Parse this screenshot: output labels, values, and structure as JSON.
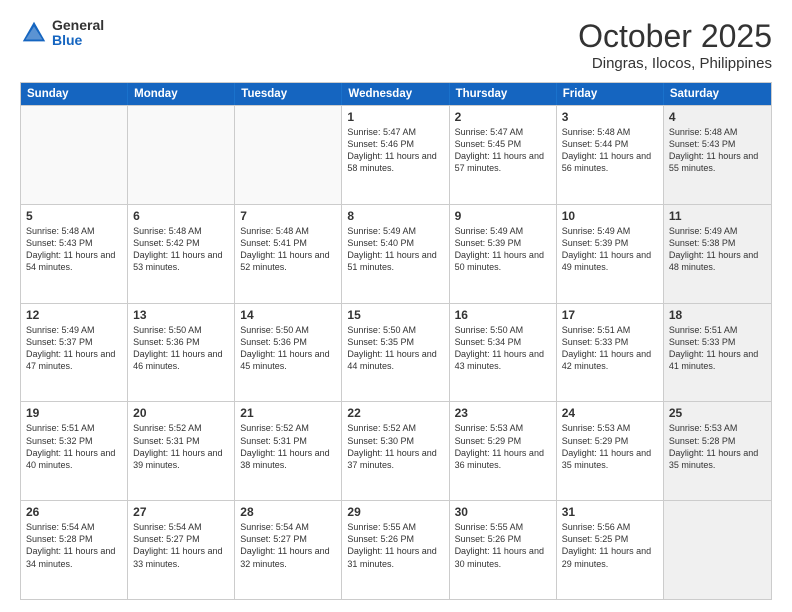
{
  "header": {
    "logo": {
      "general": "General",
      "blue": "Blue"
    },
    "title": "October 2025",
    "subtitle": "Dingras, Ilocos, Philippines"
  },
  "days_of_week": [
    "Sunday",
    "Monday",
    "Tuesday",
    "Wednesday",
    "Thursday",
    "Friday",
    "Saturday"
  ],
  "weeks": [
    [
      {
        "day": "",
        "empty": true
      },
      {
        "day": "",
        "empty": true
      },
      {
        "day": "",
        "empty": true
      },
      {
        "day": "1",
        "sunrise": "Sunrise: 5:47 AM",
        "sunset": "Sunset: 5:46 PM",
        "daylight": "Daylight: 11 hours and 58 minutes."
      },
      {
        "day": "2",
        "sunrise": "Sunrise: 5:47 AM",
        "sunset": "Sunset: 5:45 PM",
        "daylight": "Daylight: 11 hours and 57 minutes."
      },
      {
        "day": "3",
        "sunrise": "Sunrise: 5:48 AM",
        "sunset": "Sunset: 5:44 PM",
        "daylight": "Daylight: 11 hours and 56 minutes."
      },
      {
        "day": "4",
        "sunrise": "Sunrise: 5:48 AM",
        "sunset": "Sunset: 5:43 PM",
        "daylight": "Daylight: 11 hours and 55 minutes.",
        "shaded": true
      }
    ],
    [
      {
        "day": "5",
        "sunrise": "Sunrise: 5:48 AM",
        "sunset": "Sunset: 5:43 PM",
        "daylight": "Daylight: 11 hours and 54 minutes."
      },
      {
        "day": "6",
        "sunrise": "Sunrise: 5:48 AM",
        "sunset": "Sunset: 5:42 PM",
        "daylight": "Daylight: 11 hours and 53 minutes."
      },
      {
        "day": "7",
        "sunrise": "Sunrise: 5:48 AM",
        "sunset": "Sunset: 5:41 PM",
        "daylight": "Daylight: 11 hours and 52 minutes."
      },
      {
        "day": "8",
        "sunrise": "Sunrise: 5:49 AM",
        "sunset": "Sunset: 5:40 PM",
        "daylight": "Daylight: 11 hours and 51 minutes."
      },
      {
        "day": "9",
        "sunrise": "Sunrise: 5:49 AM",
        "sunset": "Sunset: 5:39 PM",
        "daylight": "Daylight: 11 hours and 50 minutes."
      },
      {
        "day": "10",
        "sunrise": "Sunrise: 5:49 AM",
        "sunset": "Sunset: 5:39 PM",
        "daylight": "Daylight: 11 hours and 49 minutes."
      },
      {
        "day": "11",
        "sunrise": "Sunrise: 5:49 AM",
        "sunset": "Sunset: 5:38 PM",
        "daylight": "Daylight: 11 hours and 48 minutes.",
        "shaded": true
      }
    ],
    [
      {
        "day": "12",
        "sunrise": "Sunrise: 5:49 AM",
        "sunset": "Sunset: 5:37 PM",
        "daylight": "Daylight: 11 hours and 47 minutes."
      },
      {
        "day": "13",
        "sunrise": "Sunrise: 5:50 AM",
        "sunset": "Sunset: 5:36 PM",
        "daylight": "Daylight: 11 hours and 46 minutes."
      },
      {
        "day": "14",
        "sunrise": "Sunrise: 5:50 AM",
        "sunset": "Sunset: 5:36 PM",
        "daylight": "Daylight: 11 hours and 45 minutes."
      },
      {
        "day": "15",
        "sunrise": "Sunrise: 5:50 AM",
        "sunset": "Sunset: 5:35 PM",
        "daylight": "Daylight: 11 hours and 44 minutes."
      },
      {
        "day": "16",
        "sunrise": "Sunrise: 5:50 AM",
        "sunset": "Sunset: 5:34 PM",
        "daylight": "Daylight: 11 hours and 43 minutes."
      },
      {
        "day": "17",
        "sunrise": "Sunrise: 5:51 AM",
        "sunset": "Sunset: 5:33 PM",
        "daylight": "Daylight: 11 hours and 42 minutes."
      },
      {
        "day": "18",
        "sunrise": "Sunrise: 5:51 AM",
        "sunset": "Sunset: 5:33 PM",
        "daylight": "Daylight: 11 hours and 41 minutes.",
        "shaded": true
      }
    ],
    [
      {
        "day": "19",
        "sunrise": "Sunrise: 5:51 AM",
        "sunset": "Sunset: 5:32 PM",
        "daylight": "Daylight: 11 hours and 40 minutes."
      },
      {
        "day": "20",
        "sunrise": "Sunrise: 5:52 AM",
        "sunset": "Sunset: 5:31 PM",
        "daylight": "Daylight: 11 hours and 39 minutes."
      },
      {
        "day": "21",
        "sunrise": "Sunrise: 5:52 AM",
        "sunset": "Sunset: 5:31 PM",
        "daylight": "Daylight: 11 hours and 38 minutes."
      },
      {
        "day": "22",
        "sunrise": "Sunrise: 5:52 AM",
        "sunset": "Sunset: 5:30 PM",
        "daylight": "Daylight: 11 hours and 37 minutes."
      },
      {
        "day": "23",
        "sunrise": "Sunrise: 5:53 AM",
        "sunset": "Sunset: 5:29 PM",
        "daylight": "Daylight: 11 hours and 36 minutes."
      },
      {
        "day": "24",
        "sunrise": "Sunrise: 5:53 AM",
        "sunset": "Sunset: 5:29 PM",
        "daylight": "Daylight: 11 hours and 35 minutes."
      },
      {
        "day": "25",
        "sunrise": "Sunrise: 5:53 AM",
        "sunset": "Sunset: 5:28 PM",
        "daylight": "Daylight: 11 hours and 35 minutes.",
        "shaded": true
      }
    ],
    [
      {
        "day": "26",
        "sunrise": "Sunrise: 5:54 AM",
        "sunset": "Sunset: 5:28 PM",
        "daylight": "Daylight: 11 hours and 34 minutes."
      },
      {
        "day": "27",
        "sunrise": "Sunrise: 5:54 AM",
        "sunset": "Sunset: 5:27 PM",
        "daylight": "Daylight: 11 hours and 33 minutes."
      },
      {
        "day": "28",
        "sunrise": "Sunrise: 5:54 AM",
        "sunset": "Sunset: 5:27 PM",
        "daylight": "Daylight: 11 hours and 32 minutes."
      },
      {
        "day": "29",
        "sunrise": "Sunrise: 5:55 AM",
        "sunset": "Sunset: 5:26 PM",
        "daylight": "Daylight: 11 hours and 31 minutes."
      },
      {
        "day": "30",
        "sunrise": "Sunrise: 5:55 AM",
        "sunset": "Sunset: 5:26 PM",
        "daylight": "Daylight: 11 hours and 30 minutes."
      },
      {
        "day": "31",
        "sunrise": "Sunrise: 5:56 AM",
        "sunset": "Sunset: 5:25 PM",
        "daylight": "Daylight: 11 hours and 29 minutes."
      },
      {
        "day": "",
        "empty": true,
        "shaded": true
      }
    ]
  ]
}
